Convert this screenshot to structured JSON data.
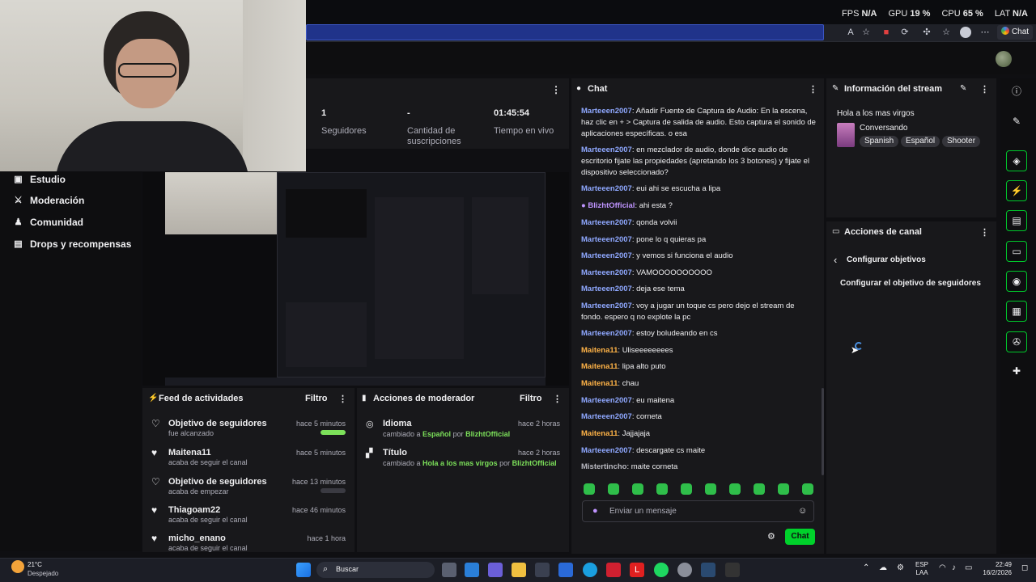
{
  "perf": {
    "fps_label": "FPS",
    "fps": "N/A",
    "gpu_label": "GPU",
    "gpu": "19 %",
    "cpu_label": "CPU",
    "cpu": "65 %",
    "lat_label": "LAT",
    "lat": "N/A"
  },
  "browser": {
    "chat_button": "Chat"
  },
  "nav": {
    "items": [
      {
        "label": "Estudio",
        "icon": "monitor-icon"
      },
      {
        "label": "Moderación",
        "icon": "sword-icon"
      },
      {
        "label": "Comunidad",
        "icon": "community-icon"
      },
      {
        "label": "Drops y recompensas",
        "icon": "gift-icon"
      }
    ]
  },
  "stats": [
    {
      "value": "1",
      "label": "Seguidores"
    },
    {
      "value": "-",
      "label": "Cantidad de suscripciones"
    },
    {
      "value": "01:45:54",
      "label": "Tiempo en vivo"
    }
  ],
  "activity": {
    "title": "Feed de actividades",
    "filter": "Filtro",
    "items": [
      {
        "title": "Objetivo de seguidores",
        "sub": "fue alcanzado",
        "time": "hace 5 minutos",
        "progress": 1.0,
        "icon": "heart-outline-icon"
      },
      {
        "title": "Maitena11",
        "sub": "acaba de seguir el canal",
        "time": "hace 5 minutos",
        "icon": "heart-icon"
      },
      {
        "title": "Objetivo de seguidores",
        "sub": "acaba de empezar",
        "time": "hace 13 minutos",
        "progress": 0.0,
        "icon": "heart-outline-icon"
      },
      {
        "title": "Thiagoam22",
        "sub": "acaba de seguir el canal",
        "time": "hace 46 minutos",
        "icon": "heart-icon"
      },
      {
        "title": "micho_enano",
        "sub": "acaba de seguir el canal",
        "time": "hace 1 hora",
        "icon": "heart-icon"
      }
    ]
  },
  "modactions": {
    "title": "Acciones de moderador",
    "filter": "Filtro",
    "items": [
      {
        "title": "Idioma",
        "pre": "cambiado a",
        "value": "Español",
        "by": "por",
        "user": "BlizhtOfficial",
        "time": "hace 2 horas",
        "icon": "globe-icon"
      },
      {
        "title": "Título",
        "pre": "cambiado a",
        "value": "Hola a los mas virgos",
        "by": "por",
        "user": "BlizhtOfficial",
        "time": "hace 2 horas",
        "icon": "title-icon"
      }
    ]
  },
  "chat": {
    "title": "Chat",
    "messages": [
      {
        "user": "Marteeen2007",
        "color": "#8fa8ff",
        "text": ": Añadir Fuente de Captura de Audio: En la escena, haz clic en + > Captura de salida de audio. Esto captura el sonido de aplicaciones específicas. o esa"
      },
      {
        "user": "Marteeen2007",
        "color": "#8fa8ff",
        "text": ": en mezclador de audio, donde dice audio de escritorio fijate las propiedades (apretando los 3 botones) y fijate el dispositivo seleccionado?"
      },
      {
        "user": "Marteeen2007",
        "color": "#8fa8ff",
        "text": ": eui ahi se escucha a lipa"
      },
      {
        "user": "BlizhtOfficial",
        "color": "#bf94ff",
        "text": ": ahi esta ?"
      },
      {
        "user": "Marteeen2007",
        "color": "#8fa8ff",
        "text": ": qonda volvii"
      },
      {
        "user": "Marteeen2007",
        "color": "#8fa8ff",
        "text": ": pone lo q quieras pa"
      },
      {
        "user": "Marteeen2007",
        "color": "#8fa8ff",
        "text": ": y vemos si funciona el audio"
      },
      {
        "user": "Marteeen2007",
        "color": "#8fa8ff",
        "text": ": VAMOOOOOOOOOO"
      },
      {
        "user": "Marteeen2007",
        "color": "#8fa8ff",
        "text": ": deja ese tema"
      },
      {
        "user": "Marteeen2007",
        "color": "#8fa8ff",
        "text": ": voy a jugar un toque cs pero dejo el stream de fondo. espero q no explote la pc"
      },
      {
        "user": "Marteeen2007",
        "color": "#8fa8ff",
        "text": ": estoy boludeando en cs"
      },
      {
        "user": "Maitena11",
        "color": "#ffb347",
        "text": ": Uliseeeeeeees"
      },
      {
        "user": "Maitena11",
        "color": "#ffb347",
        "text": ": lipa alto puto"
      },
      {
        "user": "Maitena11",
        "color": "#ffb347",
        "text": ": chau"
      },
      {
        "user": "Marteeen2007",
        "color": "#8fa8ff",
        "text": ": eu maitena"
      },
      {
        "user": "Marteeen2007",
        "color": "#8fa8ff",
        "text": ": corneta"
      },
      {
        "user": "Maitena11",
        "color": "#ffb347",
        "text": ": Jajjajaja"
      },
      {
        "user": "Marteeen2007",
        "color": "#8fa8ff",
        "text": ": descargate cs maite"
      },
      {
        "user": "Mistertincho",
        "color": "#b8b8c0",
        "text": ": maite corneta"
      }
    ],
    "input_placeholder": "Enviar un mensaje",
    "send_label": "Chat"
  },
  "stream_info": {
    "title": "Información del stream",
    "stream_title": "Hola a los mas virgos",
    "category": "Conversando",
    "tags": [
      "Spanish",
      "Español",
      "Shooter"
    ]
  },
  "channel_actions": {
    "title": "Acciones de canal",
    "back_label": "Configurar objetivos",
    "item": "Configurar el objetivo de seguidores"
  },
  "taskbar": {
    "weather_temp": "21°C",
    "weather_desc": "Despejado",
    "search": "Buscar",
    "lang1": "ESP",
    "lang2": "LAA",
    "time": "22:49",
    "date": "16/2/2026"
  }
}
